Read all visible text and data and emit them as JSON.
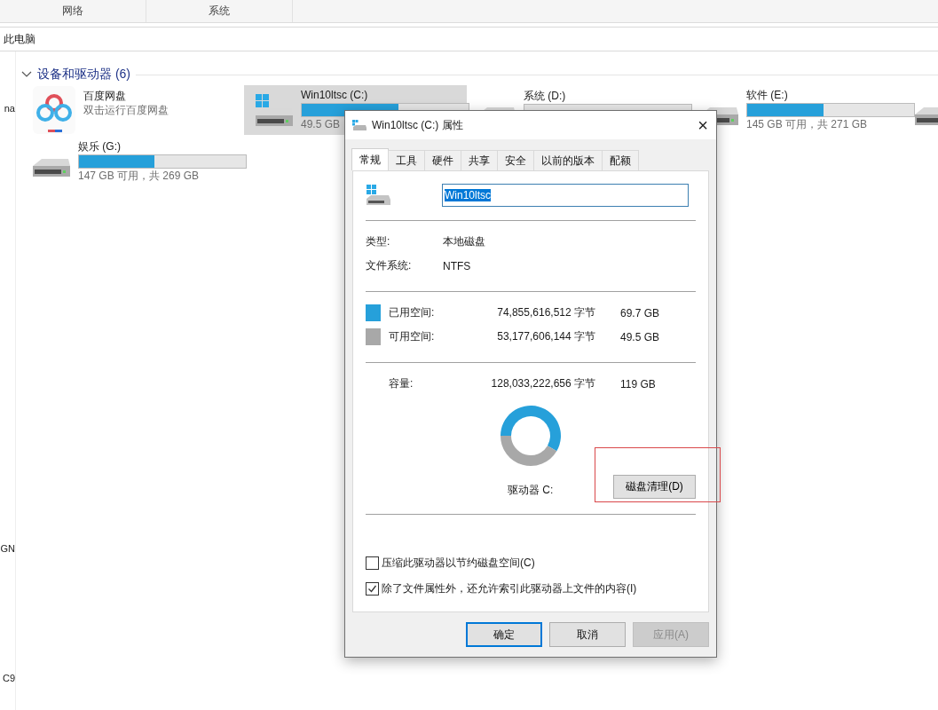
{
  "ribbon_tabs": [
    {
      "label": "网络"
    },
    {
      "label": "系统"
    }
  ],
  "address_bar": {
    "path": "此电脑"
  },
  "nav_pane": {
    "items": [
      {
        "label": "na"
      },
      {
        "label": "GN"
      },
      {
        "label": "C9"
      }
    ]
  },
  "group": {
    "title": "设备和驱动器 (6)",
    "expanded": true
  },
  "drives": [
    {
      "kind": "app",
      "name": "百度网盘",
      "subtitle": "双击运行百度网盘",
      "selected": false
    },
    {
      "kind": "system",
      "name": "Win10ltsc (C:)",
      "level": 0.58,
      "subtitle": "49.5 GB",
      "selected": true
    },
    {
      "kind": "disk",
      "name": "系统 (D:)",
      "selected": false
    },
    {
      "kind": "disk",
      "name": "软件 (E:)",
      "level": 0.46,
      "subtitle": "145 GB 可用，共 271 GB",
      "selected": false
    },
    {
      "kind": "disk_partial",
      "selected": false
    },
    {
      "kind": "disk",
      "name": "娱乐 (G:)",
      "level": 0.45,
      "subtitle": "147 GB 可用，共 269 GB",
      "selected": false
    }
  ],
  "dialog": {
    "title": "Win10ltsc (C:) 属性",
    "close": "×",
    "tabs": [
      {
        "label": "常规",
        "selected": true
      },
      {
        "label": "工具",
        "selected": false
      },
      {
        "label": "硬件",
        "selected": false
      },
      {
        "label": "共享",
        "selected": false
      },
      {
        "label": "安全",
        "selected": false
      },
      {
        "label": "以前的版本",
        "selected": false
      },
      {
        "label": "配额",
        "selected": false
      }
    ],
    "name_field": {
      "value": "Win10ltsc",
      "value_selected": true
    },
    "info": [
      {
        "label": "类型:",
        "value": "本地磁盘"
      },
      {
        "label": "文件系统:",
        "value": "NTFS"
      }
    ],
    "space": [
      {
        "label": "已用空间:",
        "bytes": "74,855,616,512 字节",
        "size": "69.7 GB",
        "color": "#26a0da"
      },
      {
        "label": "可用空间:",
        "bytes": "53,177,606,144 字节",
        "size": "49.5 GB",
        "color": "#a8a8a8"
      }
    ],
    "capacity": {
      "label": "容量:",
      "bytes": "128,033,222,656 字节",
      "size": "119 GB"
    },
    "chart_data": {
      "type": "donut",
      "values": [
        58.47,
        41.53
      ]
    },
    "drive_label": "驱动器 C:",
    "cleanup_button": "磁盘清理(D)",
    "options": [
      {
        "label": "压缩此驱动器以节约磁盘空间(C)",
        "checked": false
      },
      {
        "label": "除了文件属性外，还允许索引此驱动器上文件的内容(I)",
        "checked": true
      }
    ],
    "buttons": [
      {
        "label": "确定",
        "kind": "default",
        "disabled": false
      },
      {
        "label": "取消",
        "kind": "normal",
        "disabled": false
      },
      {
        "label": "应用(A)",
        "kind": "normal",
        "disabled": true
      }
    ]
  }
}
